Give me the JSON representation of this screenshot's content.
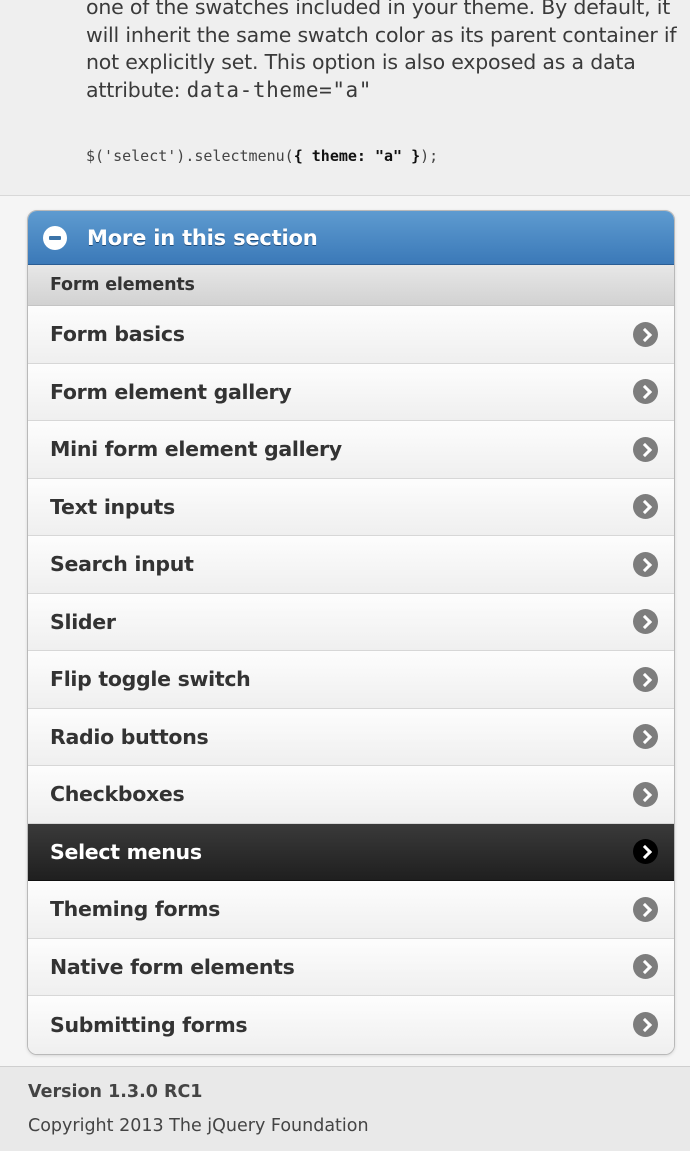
{
  "doc": {
    "para_text": "one of the swatches included in your theme. By default, it will inherit the same swatch color as its parent container if not explicitly set. This option is also exposed as a data attribute: ",
    "para_code": "data-theme=\"a\"",
    "code_prefix": "$('select').selectmenu(",
    "code_bold": "{ theme: \"a\" }",
    "code_suffix": ");"
  },
  "section": {
    "heading": "More in this section",
    "divider": "Form elements",
    "items": [
      {
        "label": "Form basics"
      },
      {
        "label": "Form element gallery"
      },
      {
        "label": "Mini form element gallery"
      },
      {
        "label": "Text inputs"
      },
      {
        "label": "Search input"
      },
      {
        "label": "Slider"
      },
      {
        "label": "Flip toggle switch"
      },
      {
        "label": "Radio buttons"
      },
      {
        "label": "Checkboxes"
      },
      {
        "label": "Select menus"
      },
      {
        "label": "Theming forms"
      },
      {
        "label": "Native form elements"
      },
      {
        "label": "Submitting forms"
      }
    ]
  },
  "footer": {
    "version": "Version 1.3.0 RC1",
    "copyright": "Copyright 2013 The jQuery Foundation"
  },
  "colors": {
    "heading_blue": "#3b79b8",
    "active_item": "#1f1f1f"
  }
}
